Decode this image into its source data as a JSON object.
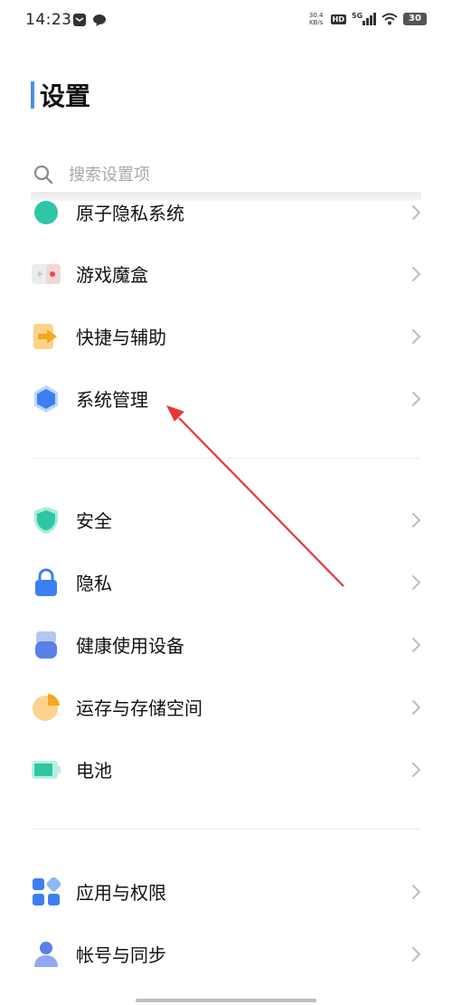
{
  "status_bar": {
    "time": "14:23",
    "net_speed_value": "30.4",
    "net_speed_unit": "KB/s",
    "hd": "HD",
    "network": "5G",
    "battery": "30"
  },
  "page": {
    "title": "设置",
    "search_placeholder": "搜索设置项"
  },
  "group_top": {
    "partial_item_label": "原子隐私系统",
    "items": [
      {
        "label": "游戏魔盒"
      },
      {
        "label": "快捷与辅助"
      },
      {
        "label": "系统管理"
      }
    ]
  },
  "group_security": {
    "items": [
      {
        "label": "安全"
      },
      {
        "label": "隐私"
      },
      {
        "label": "健康使用设备"
      },
      {
        "label": "运存与存储空间"
      },
      {
        "label": "电池"
      }
    ]
  },
  "group_apps": {
    "items": [
      {
        "label": "应用与权限"
      },
      {
        "label": "帐号与同步"
      }
    ]
  },
  "colors": {
    "accent_blue": "#4a8df0",
    "annotation_red": "#e53935",
    "teal": "#2fc6a6",
    "orange": "#f5a623"
  }
}
